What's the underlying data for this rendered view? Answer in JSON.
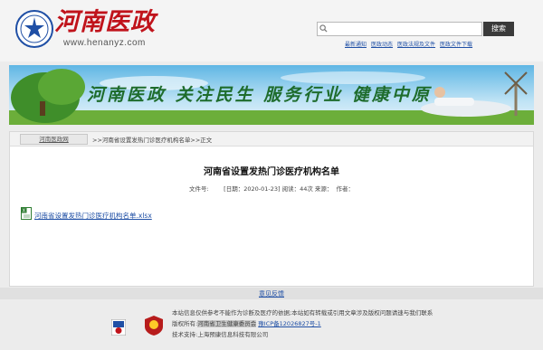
{
  "header": {
    "site_title": "河南医政",
    "site_url": "www.henanyz.com",
    "search_button": "搜索",
    "search_placeholder": "",
    "quick_links": [
      "最新通知",
      "医政动态",
      "医政法规及文件",
      "医政文件下载"
    ]
  },
  "banner": {
    "slogan": "河南医政  关注民生  服务行业  健康中原"
  },
  "breadcrumb": {
    "home": "河南医政网",
    "path": ">>河南省设置发热门诊医疗机构名单>>正文"
  },
  "article": {
    "title": "河南省设置发热门诊医疗机构名单",
    "meta": "文件号:        [日期：2020-01-23] 阅读：44次 来源：  作者：",
    "attachment": "河南省设置发热门诊医疗机构名单.xlsx"
  },
  "feedback": "意见反馈",
  "footer": {
    "line1": "本站信息仅供参考不能作为诊断及医疗的依据;本站如有转载或引用文章涉及版权问题请速与我们联系",
    "line2_prefix": "版权所有:",
    "owner": "河南省卫生健康委员会",
    "icp": "豫ICP备12026827号-1",
    "line3": "技术支持:上海预康信息科技有限公司"
  },
  "colors": {
    "brand_red": "#c0131b",
    "link_blue": "#1f4fa5",
    "slogan_green": "#1e6c2c"
  }
}
